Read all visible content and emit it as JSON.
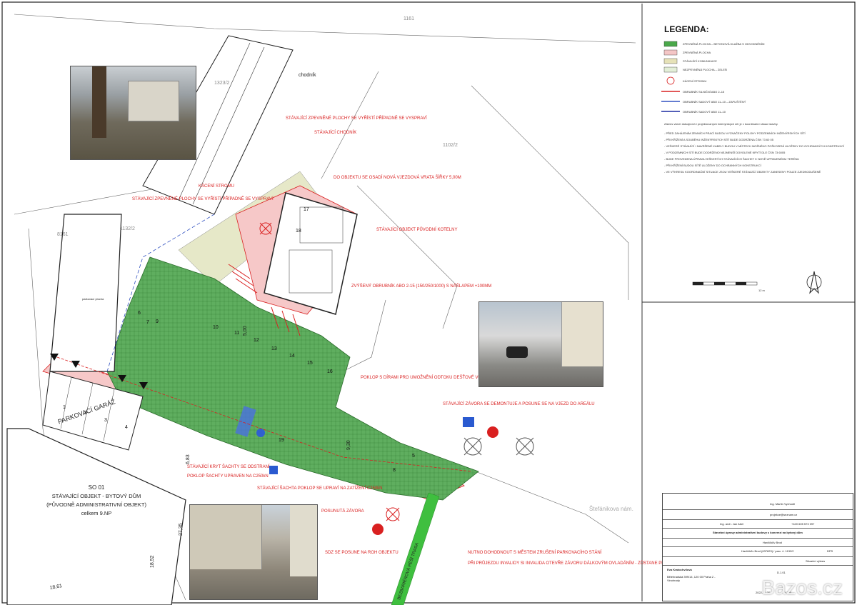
{
  "legend": {
    "title": "LEGENDA:",
    "items": [
      {
        "label": "ZPEVNĚNÁ PLOCHA – BETONOVÁ DLAŽBA S ODVODNĚNÍM",
        "color": "#4aa84a"
      },
      {
        "label": "ZPEVNĚNÁ PLOCHA",
        "color": "#f4c6c6"
      },
      {
        "label": "STÁVAJÍCÍ KOMUNIKACE",
        "color": "#e6e2b8"
      },
      {
        "label": "NEZPEVNĚNÁ PLOCHA – ZELEŇ",
        "color": "#e3efd8"
      },
      {
        "label": "KÁCENÍ STROMU",
        "color": "#d92020"
      },
      {
        "label": "OBRUBNÍK SILNIČNÍ ABO 2–15",
        "color": "#d92020"
      },
      {
        "label": "OBRUBNÍK SADOVÝ ABO 11–10 – ZAPUŠTĚNÝ",
        "color": "#3050c0"
      },
      {
        "label": "OBRUBNÍK SADOVÝ ABO 11–10",
        "color": "#1a2aa0"
      }
    ],
    "note": "Zákres všech stávajících i projektovaných inženýrských sítí je v koordinační situaci stavby.",
    "conditions": [
      "- PŘED ZAHÁJENÍM ZEMNÍCH PRACÍ BUDOU VYZNAČENY POLOHY PODZEMNÍCH INŽENÝRSKÝCH SÍTÍ",
      "- PŘI KŘÍŽENÍ A SOUBĚHU INŽENÝRSKÝCH SÍTÍ BUDE DODRŽENA ČSN 73 60 05",
      "- VEŠKERÉ STÁVAJÍCÍ I NAVRŽENÉ KABELY BUDOU V MÍSTECH MOŽNÉHO POŠKOZENÍ ULOŽENY DO OCHRANNÝCH KONSTRUKCÍ",
      "- V PODZEMNÍCH SÍTÍ BUDE DODRŽENO NEJMENŠÍ DOVOLENÉ KRYTÍ DLE ČSN 73 6005",
      "- BUDE PROVEDENA ÚPRAVA VEŠKERÝCH STÁVAJÍCÍCH ŠACHET K NOVĚ UPRAVENÉMU TERÉNU",
      "- PŘI KŘÍŽENÍ BUDOU SÍTĚ ULOŽENY DO OCHRANNÝCH KONSTRUKCÍ",
      "- VE VÝKRESU KOORDINAČNÍ SITUACE JSOU VEŠKERÉ STÁVAJÍCÍ OBJEKTY ZANESENY POUZE ZJEDNODUŠENĚ"
    ],
    "scale_label": "12 m"
  },
  "annotations": {
    "chodnik": "chodník",
    "demolition": "STÁVAJÍCÍ ZPEVNĚNÉ PLOCHY SE VYŘÍSTÍ PŘÍPADNĚ SE VYSPRAVÍ",
    "existing_walk": "STÁVAJÍCÍ CHODNÍK",
    "gate": "DO OBJEKTU SE OSADÍ NOVÁ VJEZDOVÁ VRATA ŠÍŘKY  5,00M",
    "tree_cut": "KÁCENÍ STROMU",
    "demolition2": "STÁVAJÍCÍ ZPEVNĚNÉ PLOCHY SE VYŘÍSTÍ PŘÍPADNĚ SE VYSPRAVÍ",
    "boiler": "STÁVAJÍCÍ OBJEKT PŮVODNÍ KOTELNY",
    "curb": "ZVÝŠENÝ OBRUBNÍK ABO 2-15 (150/250/1000) S NÁŠLAPEM +100MM",
    "grate": "POKLOP S DÍRAMI PRO UMOŽNĚNÍ ODTOKU DEŠŤOVÉ VODY",
    "barrier_move": "STÁVAJÍCÍ ZÁVORA SE DEMONTUJE A POSUNE SE NA VJEZD DO AREÁLU",
    "shed": "STÁVAJÍCÍ KRYT ŠACHTY SE ODSTRANÍ",
    "manhole": "POKLOP ŠACHTY UPRAVEN NA C250kN",
    "manhole2": "STÁVAJÍCÍ ŠACHTA POKLOP SE UPRAVÍ NA ZATÍŽENÍ C250kN",
    "barrier_shifted": "POSUNUTÁ ZÁVORA",
    "sign": "SDZ SE POSUNE NA ROH OBJEKTU",
    "parking_negotiate": "NUTNO DOHODNOUT S MĚSTEM ZRUŠENÍ PARKOVACÍHO STÁNÍ",
    "wheelchair": "PŘI PRŮJEZDU INVALIDY SI INVALIDA OTEVŘE ZÁVORU DÁLKOVÝM OVLADÁNÍM - ZŮSTANE PRŮJEZD KOLEM ZÁVORY V ŠÍŘCE 900MM",
    "garage": "PARKOVACÍ GARÁŽ",
    "parking_area": "parkovací plocha",
    "walkway": "BEZBARIÉROVÁ PĚŠÍ TRASA",
    "street": "Štefánikova nám.",
    "parcel_1161": "1161",
    "parcel_1323": "1323/2",
    "parcel_1132": "1132/2",
    "parcel_1102": "1102/2",
    "parcel_816": "8161"
  },
  "building": {
    "code": "SO 01",
    "line1": "STÁVAJÍCÍ OBJEKT - BYTOVÝ DŮM",
    "line2": "(PŮVODNĚ ADMINISTRATIVNÍ OBJEKT)",
    "line3": "celkem 9.NP"
  },
  "parking_numbers": [
    "1",
    "2",
    "3",
    "4",
    "5",
    "6",
    "7",
    "8",
    "9",
    "10",
    "11",
    "12",
    "13",
    "14",
    "15",
    "16",
    "17",
    "18",
    "19"
  ],
  "dimensions": [
    "6,83",
    "27,35",
    "18,52",
    "18,61",
    "9,30",
    "5,00"
  ],
  "title_block": {
    "designer": "Ing. Martin Vychodil",
    "email": "projekce@seznam.cz",
    "author": "Ing. arch. Jan Abel",
    "phone": "+420 605 573 097",
    "project": "Stavební úpravy administrativní budovy s konverzí na bytový dům",
    "place": "Havlíčkův Brod",
    "cadastre": "Havlíčkův Brod (637823) / parc. č. 1132/2",
    "stage": "DPS",
    "drawing": "Situační výkres",
    "client": "Eva Kratochvílová",
    "address": "Bělehradská 399/14, 120 00 Praha 2 - Vinohrady",
    "date": "2022-11-20",
    "scale": "1:200",
    "number": "D.1.01"
  },
  "watermark": "Bazos.cz"
}
